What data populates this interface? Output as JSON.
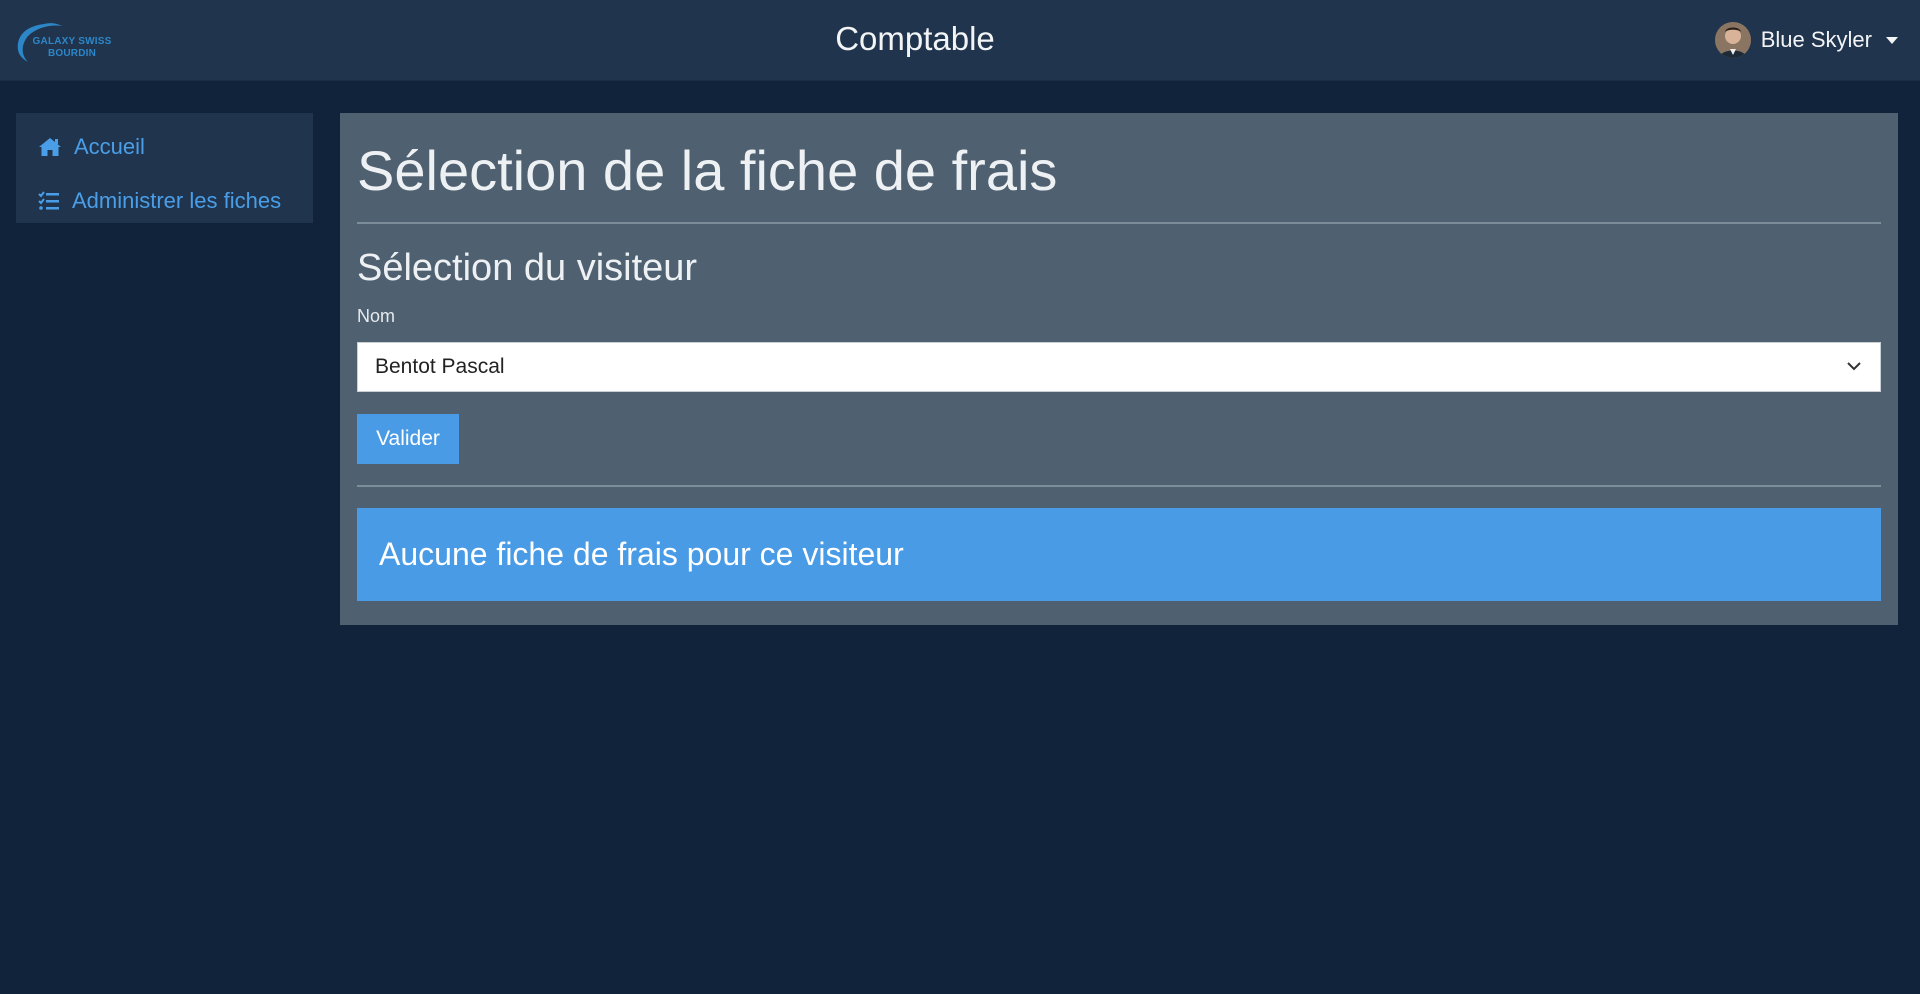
{
  "header": {
    "logo_text": "GALAXY SWISS BOURDIN",
    "app_title": "Comptable",
    "user_name": "Blue Skyler",
    "user_avatar_icon": "user-avatar",
    "user_menu_icon": "caret-down-icon"
  },
  "sidebar": {
    "items": [
      {
        "label": "Accueil",
        "icon": "home-icon"
      },
      {
        "label": "Administrer les fiches",
        "icon": "tasks-list-icon"
      }
    ]
  },
  "main": {
    "page_title": "Sélection de la fiche de frais",
    "section_title": "Sélection du visiteur",
    "visitor_field": {
      "label": "Nom",
      "selected_value": "Bentot Pascal"
    },
    "submit_label": "Valider",
    "alert_message": "Aucune fiche de frais pour ce visiteur"
  },
  "colors": {
    "page_background": "#10233a",
    "navbar_background": "#20354d",
    "panel_background": "#4f6070",
    "accent": "#4a9be6",
    "link": "#4a9ee8"
  }
}
